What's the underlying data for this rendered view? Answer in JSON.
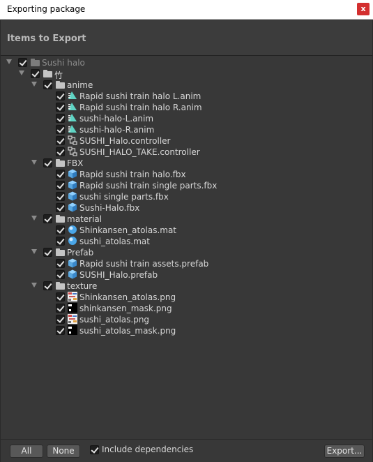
{
  "window": {
    "title": "Exporting package",
    "close_label": "x"
  },
  "header": {
    "title": "Items to Export"
  },
  "tree": [
    {
      "depth": 0,
      "type": "folder",
      "label": "Sushi halo",
      "dim": true,
      "icon": "folder-icon"
    },
    {
      "depth": 1,
      "type": "folder",
      "label": "竹",
      "icon": "folder-icon"
    },
    {
      "depth": 2,
      "type": "folder",
      "label": "anime",
      "icon": "folder-icon"
    },
    {
      "depth": 3,
      "type": "file",
      "label": "Rapid sushi train halo L.anim",
      "icon": "animation-clip-icon"
    },
    {
      "depth": 3,
      "type": "file",
      "label": "Rapid sushi train halo R.anim",
      "icon": "animation-clip-icon"
    },
    {
      "depth": 3,
      "type": "file",
      "label": "sushi-halo-L.anim",
      "icon": "animation-clip-icon"
    },
    {
      "depth": 3,
      "type": "file",
      "label": "sushi-halo-R.anim",
      "icon": "animation-clip-icon"
    },
    {
      "depth": 3,
      "type": "file",
      "label": "SUSHI_Halo.controller",
      "icon": "animator-controller-icon"
    },
    {
      "depth": 3,
      "type": "file",
      "label": "SUSHI_HALO_TAKE.controller",
      "icon": "animator-controller-icon"
    },
    {
      "depth": 2,
      "type": "folder",
      "label": "FBX",
      "icon": "folder-icon"
    },
    {
      "depth": 3,
      "type": "file",
      "label": "Rapid sushi train halo.fbx",
      "icon": "model-icon"
    },
    {
      "depth": 3,
      "type": "file",
      "label": "Rapid sushi train single parts.fbx",
      "icon": "model-icon"
    },
    {
      "depth": 3,
      "type": "file",
      "label": "sushi single parts.fbx",
      "icon": "model-icon"
    },
    {
      "depth": 3,
      "type": "file",
      "label": "Sushi-Halo.fbx",
      "icon": "model-icon"
    },
    {
      "depth": 2,
      "type": "folder",
      "label": "material",
      "icon": "folder-icon"
    },
    {
      "depth": 3,
      "type": "file",
      "label": "Shinkansen_atolas.mat",
      "icon": "material-icon"
    },
    {
      "depth": 3,
      "type": "file",
      "label": "sushi_atolas.mat",
      "icon": "material-icon"
    },
    {
      "depth": 2,
      "type": "folder",
      "label": "Prefab",
      "icon": "folder-icon"
    },
    {
      "depth": 3,
      "type": "file",
      "label": "Rapid sushi train assets.prefab",
      "icon": "prefab-icon"
    },
    {
      "depth": 3,
      "type": "file",
      "label": "SUSHI_Halo.prefab",
      "icon": "prefab-icon"
    },
    {
      "depth": 2,
      "type": "folder",
      "label": "texture",
      "icon": "folder-icon"
    },
    {
      "depth": 3,
      "type": "file",
      "label": "Shinkansen_atolas.png",
      "icon": "texture-thumbnail-icon"
    },
    {
      "depth": 3,
      "type": "file",
      "label": "shinkansen_mask.png",
      "icon": "texture-mask-thumbnail-icon"
    },
    {
      "depth": 3,
      "type": "file",
      "label": "sushi_atolas.png",
      "icon": "texture-thumbnail-icon"
    },
    {
      "depth": 3,
      "type": "file",
      "label": "sushi_atolas_mask.png",
      "icon": "texture-mask-thumbnail-icon"
    }
  ],
  "footer": {
    "all_label": "All",
    "none_label": "None",
    "include_dependencies_label": "Include dependencies",
    "export_label": "Export..."
  },
  "colors": {
    "close_button": "#d32f2f",
    "background": "#383838",
    "animation_icon": "#5fd4c4",
    "model_icon": "#5aa8e0",
    "material_icon": "#4aa6e8"
  }
}
